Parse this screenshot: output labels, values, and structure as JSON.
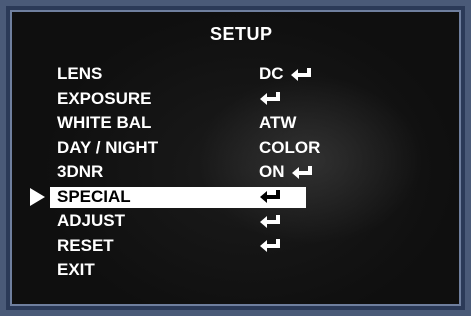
{
  "menu": {
    "title": "SETUP",
    "items": [
      {
        "label": "LENS",
        "value": "DC",
        "enter": true
      },
      {
        "label": "EXPOSURE",
        "value": "",
        "enter": true
      },
      {
        "label": "WHITE BAL",
        "value": "ATW",
        "enter": false
      },
      {
        "label": "DAY / NIGHT",
        "value": "COLOR",
        "enter": false
      },
      {
        "label": "3DNR",
        "value": "ON",
        "enter": true
      },
      {
        "label": "SPECIAL",
        "value": "",
        "enter": true
      },
      {
        "label": "ADJUST",
        "value": "",
        "enter": true
      },
      {
        "label": "RESET",
        "value": "",
        "enter": true
      },
      {
        "label": "EXIT",
        "value": "",
        "enter": false
      }
    ],
    "selected_index": 5
  },
  "icons": {
    "cursor": "right-triangle-cursor-icon",
    "enter": "enter-return-arrow-icon"
  },
  "colors": {
    "text": "#ffffff",
    "highlight": "#ffffff",
    "highlight_text": "#000000",
    "background": "#141414",
    "frame": "#2b3a58"
  }
}
